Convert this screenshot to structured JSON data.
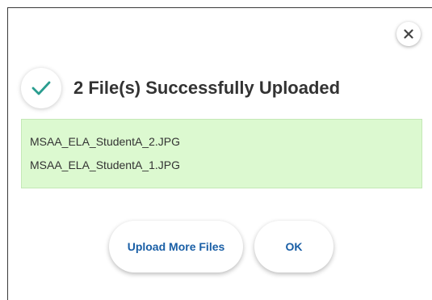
{
  "dialog": {
    "title": "2 File(s) Successfully Uploaded",
    "close_icon": "close-icon",
    "status_icon": "checkmark-icon",
    "files": [
      "MSAA_ELA_StudentA_2.JPG",
      "MSAA_ELA_StudentA_1.JPG"
    ],
    "buttons": {
      "upload_more_label": "Upload More Files",
      "ok_label": "OK"
    }
  },
  "colors": {
    "check": "#2a9d8f",
    "list_background": "#dcf9d0",
    "button_text": "#1a5fa6",
    "title_text": "#333333"
  }
}
